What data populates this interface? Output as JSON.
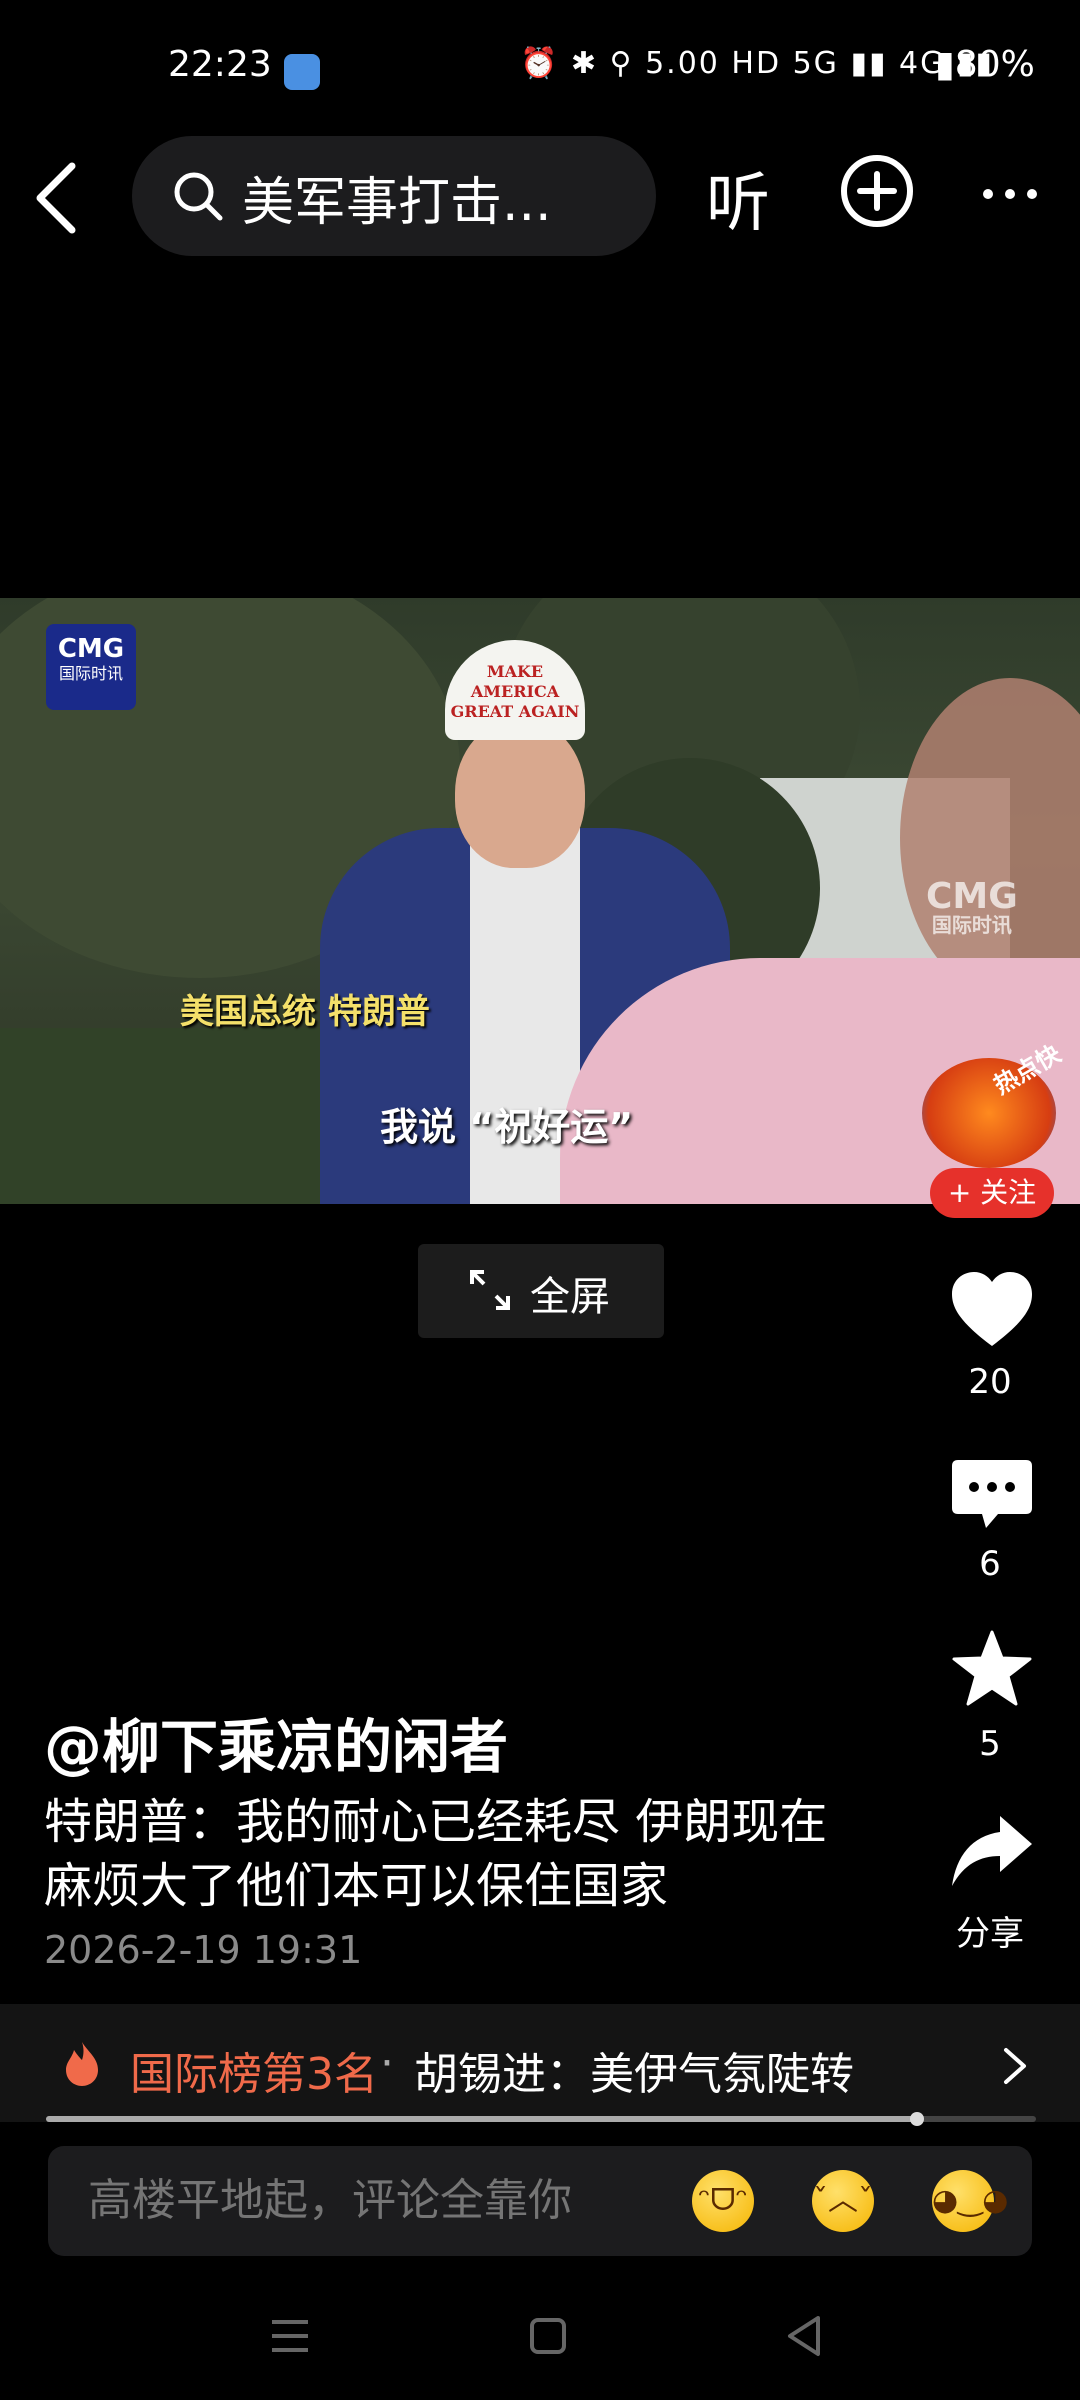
{
  "status_bar": {
    "time": "22:23",
    "icons": "⏰ ✱ ⚲ 5.00 HD 5G ▮▮ 4G ▮▮",
    "battery": "▮80%"
  },
  "top_nav": {
    "search_text": "美军事打击...",
    "listen_label": "听"
  },
  "video": {
    "logo_text": "CMG",
    "logo_sub": "国际时讯",
    "hat_text": "MAKE AMERICA GREAT AGAIN",
    "caption_name": "美国总统 特朗普",
    "caption_quote": "我说 “祝好运”",
    "hot_badge": "热点快",
    "follow_label": "+ 关注",
    "fullscreen_label": "全屏"
  },
  "actions": {
    "like_count": "20",
    "comment_count": "6",
    "favorite_count": "5",
    "share_label": "分享"
  },
  "post": {
    "author": "@柳下乘凉的闲者",
    "description": "特朗普：我的耐心已经耗尽 伊朗现在麻烦大了他们本可以保住国家",
    "timestamp": "2026-2-19 19:31"
  },
  "ranking": {
    "label": "国际榜第3名",
    "separator": "·",
    "topic": "胡锡进：美伊气氛陡转"
  },
  "progress": {
    "fraction": 0.88
  },
  "comment": {
    "placeholder": "高楼平地起，评论全靠你"
  },
  "colors": {
    "accent_red": "#e6312b",
    "rank_orange": "#f06a4a"
  }
}
